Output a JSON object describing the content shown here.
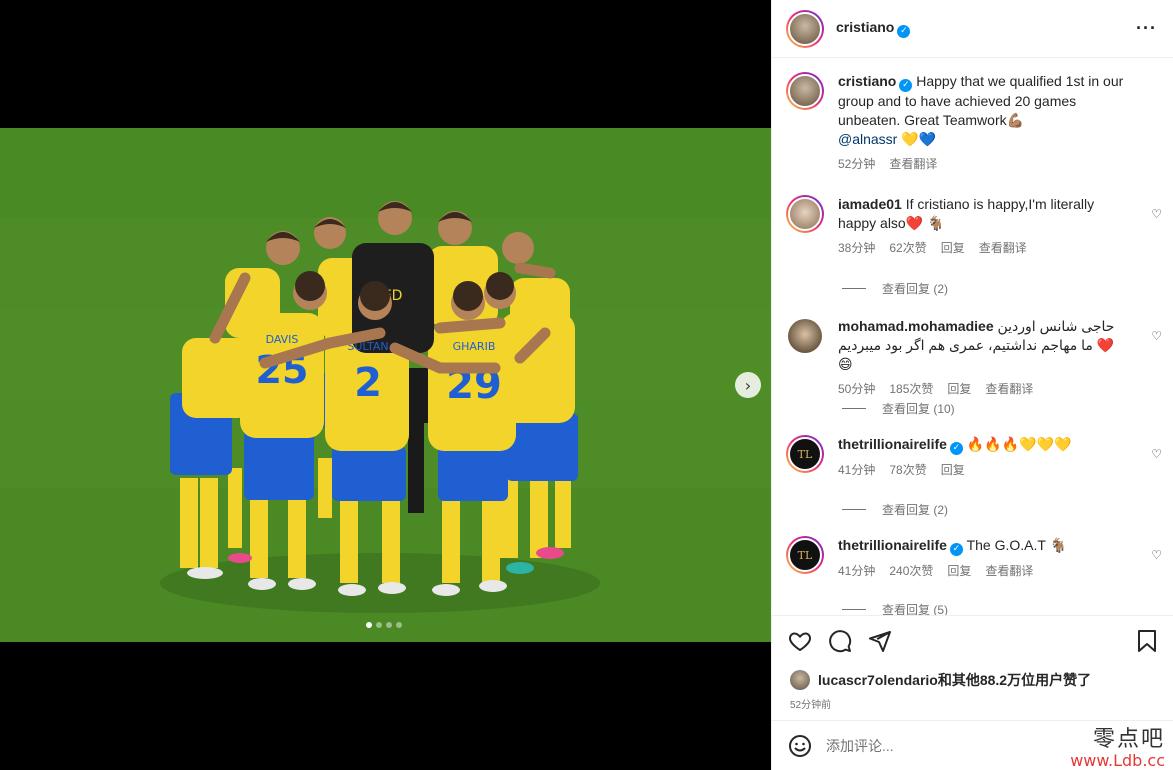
{
  "post": {
    "username": "cristiano",
    "more_icon": "more-horizontal-icon"
  },
  "caption": {
    "username": "cristiano",
    "text": "Happy that we qualified 1st in our group and to have achieved 20 games unbeaten. Great Teamwork💪🏽",
    "mention": "@alnassr",
    "emoji": "💛💙",
    "time": "52分钟",
    "translate": "查看翻译"
  },
  "comments": [
    {
      "username": "iamade01",
      "text": "If cristiano is happy,I'm literally happy also❤️ 🐐",
      "time": "38分钟",
      "likes": "62次赞",
      "reply": "回复",
      "translate": "查看翻译",
      "view_replies": "查看回复 (2)"
    },
    {
      "username": "mohamad.mohamadiee",
      "text": "حاجی شانس اوردین ما مهاجم نداشتیم، عمری هم اگر بود میبردیم",
      "emoji": "❤️😄",
      "time": "50分钟",
      "likes": "185次赞",
      "reply": "回复",
      "translate": "查看翻译",
      "view_replies": "查看回复 (10)"
    },
    {
      "username": "thetrillionairelife",
      "text": "🔥🔥🔥💛💛💛",
      "time": "41分钟",
      "likes": "78次赞",
      "reply": "回复",
      "view_replies": "查看回复 (2)"
    },
    {
      "username": "thetrillionairelife",
      "text": "The G.O.A.T 🐐",
      "time": "41分钟",
      "likes": "240次赞",
      "reply": "回复",
      "translate": "查看翻译",
      "view_replies": "查看回复 (5)"
    }
  ],
  "likes_summary": {
    "user": "lucascr7olendario",
    "rest": "和其他88.2万位用户赞了"
  },
  "post_time": "52分钟前",
  "comment_input": {
    "placeholder": "添加评论..."
  },
  "watermark": {
    "line1": "零点吧",
    "line2": "www.Ldb.cc"
  },
  "carousel": {
    "count": 4,
    "active": 0
  },
  "jersey_numbers": [
    "25",
    "2",
    "29"
  ],
  "jersey_names": [
    "DAVIS",
    "SULTAN",
    "GHARIB"
  ],
  "colors": {
    "accent": "#0095f6",
    "jersey_yellow": "#f2d42a",
    "shorts_blue": "#1f5fd1",
    "pitch_green": "#4b8a24"
  }
}
